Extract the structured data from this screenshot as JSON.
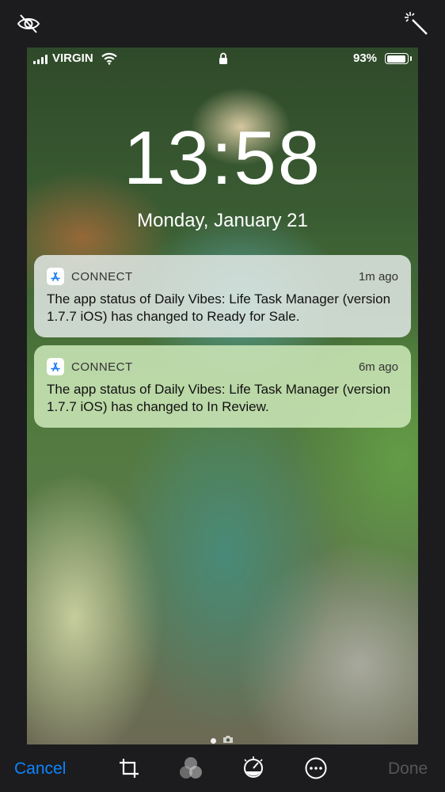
{
  "toolbar_top": {
    "left_icon": "eye-slash-icon",
    "right_icon": "magic-wand-icon"
  },
  "status_bar": {
    "carrier": "VIRGIN",
    "battery_percent": "93%",
    "battery_level": 0.93
  },
  "lock_screen": {
    "time": "13:58",
    "date": "Monday, January 21"
  },
  "notifications": [
    {
      "app": "CONNECT",
      "time": "1m ago",
      "body": "The app status of Daily Vibes: Life Task Manager (version 1.7.7 iOS) has changed to Ready for Sale."
    },
    {
      "app": "CONNECT",
      "time": "6m ago",
      "body": "The app status of Daily Vibes: Life Task Manager (version 1.7.7 iOS) has changed to In Review."
    }
  ],
  "bottom_bar": {
    "cancel_label": "Cancel",
    "done_label": "Done",
    "tools": [
      "crop-rotate-icon",
      "filters-icon",
      "adjust-icon",
      "more-icon"
    ]
  },
  "colors": {
    "accent": "#0a84ff",
    "background": "#1c1c1e",
    "done_disabled": "#555555"
  }
}
